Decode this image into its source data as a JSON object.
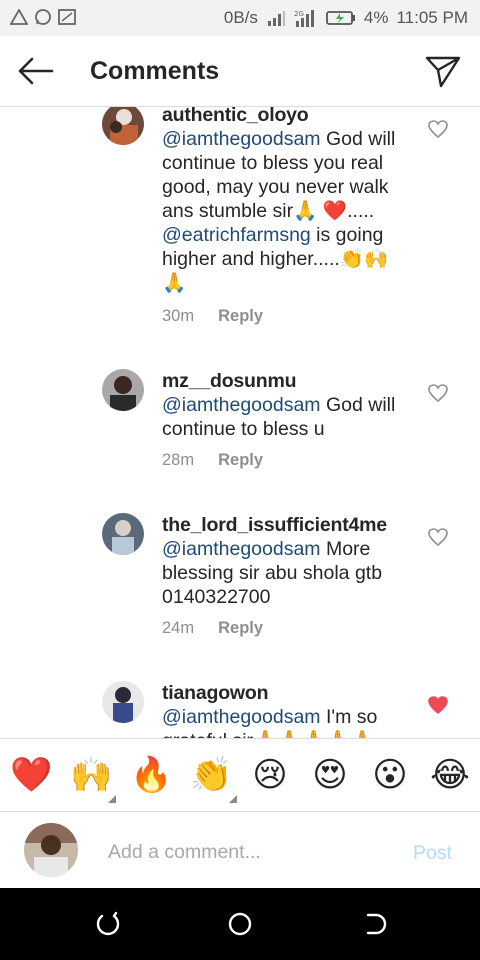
{
  "status_bar": {
    "network_speed": "0B/s",
    "battery": "4%",
    "time": "11:05 PM"
  },
  "header": {
    "title": "Comments",
    "back_icon": "arrow-left-icon",
    "send_icon": "direct-send-icon"
  },
  "comments": [
    {
      "username": "authentic_oloyo",
      "mention": "@iamthegoodsam",
      "text_parts": [
        " God will continue to bless you real good,  may you never walk ans stumble sir🙏 ❤️..... ",
        "@eatrichfarmsng",
        " is going higher and higher.....👏🙌🙏"
      ],
      "time": "30m",
      "reply": "Reply",
      "liked": false
    },
    {
      "username": "mz__dosunmu",
      "mention": "@iamthegoodsam",
      "text": " God will continue to bless u",
      "time": "28m",
      "reply": "Reply",
      "liked": false
    },
    {
      "username": "the_lord_issufficient4me",
      "mention": "@iamthegoodsam",
      "text": " More blessing sir abu shola gtb 0140322700",
      "time": "24m",
      "reply": "Reply",
      "liked": false
    },
    {
      "username": "tianagowon",
      "mention": "@iamthegoodsam",
      "text": " I'm so grateful sir🙏🙏🙏🙏🙏",
      "liked": true
    }
  ],
  "emoji_bar": [
    "❤️",
    "🙌",
    "🔥",
    "👏",
    "😢",
    "😍",
    "😮",
    "😂"
  ],
  "composer": {
    "placeholder": "Add a comment...",
    "post_label": "Post"
  },
  "colors": {
    "mention": "#1f4a78",
    "liked_heart": "#ed4956",
    "post_disabled": "#b3dbff"
  }
}
